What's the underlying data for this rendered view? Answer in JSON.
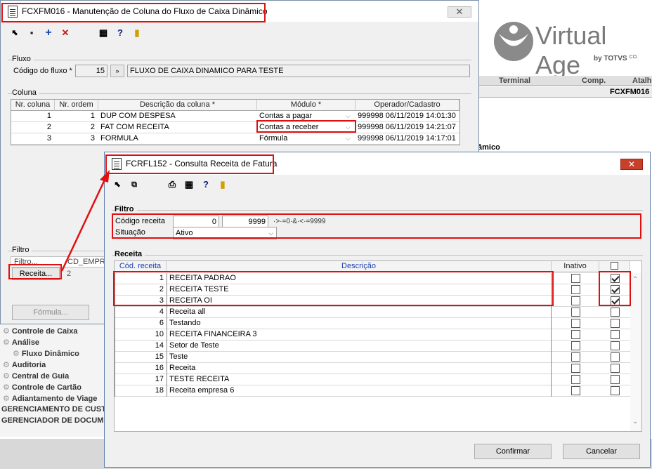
{
  "background": {
    "logo_text": "Virtual Age",
    "logo_sub": "by TOTVS",
    "logo_sub_suffix": "CO.",
    "header_terminal": "Terminal",
    "header_comp": "Comp.",
    "header_atalho": "Atalh",
    "shortcut_value": "FCXFM016",
    "partial_text": "âmico",
    "tree": [
      {
        "label": "Controle de Caixa",
        "indent": 0
      },
      {
        "label": "Análise",
        "indent": 0
      },
      {
        "label": "Fluxo Dinâmico",
        "indent": 1
      },
      {
        "label": "Auditoria",
        "indent": 0
      },
      {
        "label": "Central de Guia",
        "indent": 0
      },
      {
        "label": "Controle de Cartão",
        "indent": 0
      },
      {
        "label": "Adiantamento de Viage",
        "indent": 0
      }
    ],
    "tree_caps": [
      "GERENCIAMENTO DE CUSTO",
      "GERENCIADOR DE DOCUMEN"
    ]
  },
  "win1": {
    "title": "FCXFM016 - Manutenção de Coluna do Fluxo de Caixa Dinâmico",
    "fluxo_group": "Fluxo",
    "codigo_label": "Código do fluxo *",
    "codigo_value": "15",
    "fluxo_desc": "FLUXO DE CAIXA DINAMICO PARA TESTE",
    "coluna_group": "Coluna",
    "columns": [
      "Nr. coluna",
      "Nr. ordem",
      "Descrição da coluna *",
      "Módulo *",
      "Operador/Cadastro"
    ],
    "rows": [
      {
        "nr": "1",
        "ordem": "1",
        "desc": "DUP COM DESPESA",
        "modulo": "Contas a pagar",
        "operador": "999998 06/11/2019 14:01:30"
      },
      {
        "nr": "2",
        "ordem": "2",
        "desc": "FAT COM RECEITA",
        "modulo": "Contas a receber",
        "operador": "999998 06/11/2019 14:21:07"
      },
      {
        "nr": "3",
        "ordem": "3",
        "desc": "FORMULA",
        "modulo": "Fórmula",
        "operador": "999998 06/11/2019 14:17:01"
      }
    ],
    "filtro_group": "Filtro",
    "filtro_col1": "Filtro...",
    "filtro_col2": "CD_EMPRE",
    "receita_btn": "Receita...",
    "receita_val": "2",
    "formula_btn": "Fórmula..."
  },
  "win2": {
    "title": "FCRFL152 - Consulta Receita de Fatura",
    "filtro_group": "Filtro",
    "codigo_label": "Código receita",
    "codigo_from": "0",
    "codigo_to": "9999",
    "codigo_hint": "·>·=0·&·<·=9999",
    "situacao_label": "Situação",
    "situacao_value": "Ativo",
    "receita_group": "Receita",
    "col_cod": "Cód. receita",
    "col_desc": "Descrição",
    "col_inativo": "Inativo",
    "rows": [
      {
        "cod": "1",
        "desc": "RECEITA PADRAO",
        "inativo": false,
        "sel": true
      },
      {
        "cod": "2",
        "desc": "RECEITA TESTE",
        "inativo": false,
        "sel": true
      },
      {
        "cod": "3",
        "desc": "RECEITA OI",
        "inativo": false,
        "sel": true
      },
      {
        "cod": "4",
        "desc": "Receita all",
        "inativo": false,
        "sel": false
      },
      {
        "cod": "6",
        "desc": "Testando",
        "inativo": false,
        "sel": false
      },
      {
        "cod": "10",
        "desc": "RECEITA FINANCEIRA 3",
        "inativo": false,
        "sel": false
      },
      {
        "cod": "14",
        "desc": "Setor de Teste",
        "inativo": false,
        "sel": false
      },
      {
        "cod": "15",
        "desc": "Teste",
        "inativo": false,
        "sel": false
      },
      {
        "cod": "16",
        "desc": "Receita",
        "inativo": false,
        "sel": false
      },
      {
        "cod": "17",
        "desc": "TESTE RECEITA",
        "inativo": false,
        "sel": false
      },
      {
        "cod": "18",
        "desc": "Receita empresa 6",
        "inativo": false,
        "sel": false
      }
    ],
    "confirm_label": "Confirmar",
    "cancel_label": "Cancelar"
  },
  "colors": {
    "highlight": "#e01010",
    "titlebar": "#ffffff",
    "window": "#f0f0f0"
  }
}
